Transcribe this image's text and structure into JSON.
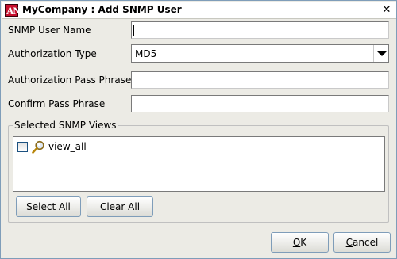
{
  "window": {
    "title": "MyCompany : Add SNMP User",
    "icon": "app-logo-icon",
    "close_glyph": "✕"
  },
  "form": {
    "user_name_label": "SNMP User Name",
    "user_name_value": "",
    "auth_type_label": "Authorization Type",
    "auth_type_value": "MD5",
    "auth_pass_label": "Authorization Pass Phrase",
    "auth_pass_value": "",
    "confirm_pass_label": "Confirm Pass Phrase",
    "confirm_pass_value": ""
  },
  "views": {
    "group_title": "Selected SNMP Views",
    "items": [
      {
        "label": "view_all",
        "checked": false,
        "icon": "magnifier-icon"
      }
    ],
    "select_all_mnemonic": "S",
    "select_all_rest": "elect All",
    "clear_all_pre": "C",
    "clear_all_mnemonic": "l",
    "clear_all_rest": "ear All"
  },
  "footer": {
    "ok_mnemonic": "O",
    "ok_rest": "K",
    "cancel_mnemonic": "C",
    "cancel_rest": "ancel"
  },
  "colors": {
    "accent": "#7f9db9",
    "brand": "#c8102e"
  }
}
